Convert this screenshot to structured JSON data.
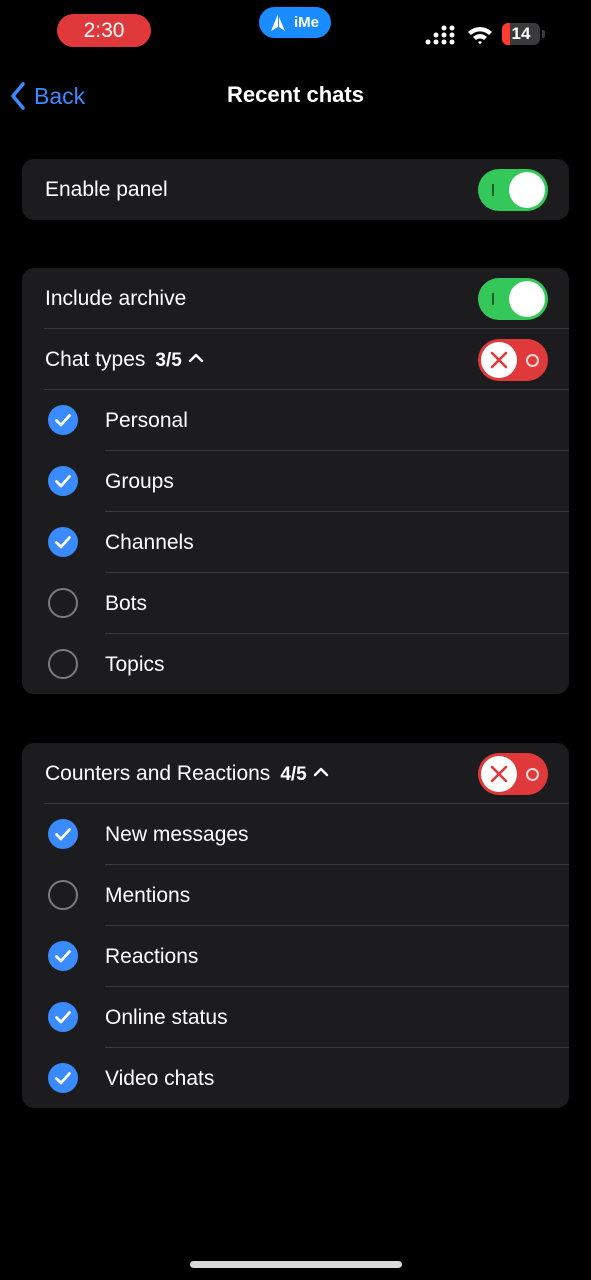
{
  "status_bar": {
    "time": "2:30",
    "app_pill": "iMe",
    "battery": "14",
    "colors": {
      "time_pill": "#e0393c",
      "app_pill": "#1a8cff"
    }
  },
  "nav": {
    "back_label": "Back",
    "title": "Recent chats"
  },
  "panel": {
    "enable_label": "Enable panel",
    "enabled": true
  },
  "chats": {
    "include_archive_label": "Include archive",
    "include_archive": true,
    "chat_types_label": "Chat types",
    "chat_types_count": "3/5",
    "items": [
      {
        "label": "Personal",
        "checked": true
      },
      {
        "label": "Groups",
        "checked": true
      },
      {
        "label": "Channels",
        "checked": true
      },
      {
        "label": "Bots",
        "checked": false
      },
      {
        "label": "Topics",
        "checked": false
      }
    ]
  },
  "counters": {
    "label": "Counters and Reactions",
    "count": "4/5",
    "items": [
      {
        "label": "New messages",
        "checked": true
      },
      {
        "label": "Mentions",
        "checked": false
      },
      {
        "label": "Reactions",
        "checked": true
      },
      {
        "label": "Online status",
        "checked": true
      },
      {
        "label": "Video chats",
        "checked": true
      }
    ]
  },
  "colors": {
    "accent": "#3a8bff",
    "toggle_on": "#34c759",
    "toggle_x": "#e0393c",
    "card": "#1c1c1e"
  }
}
